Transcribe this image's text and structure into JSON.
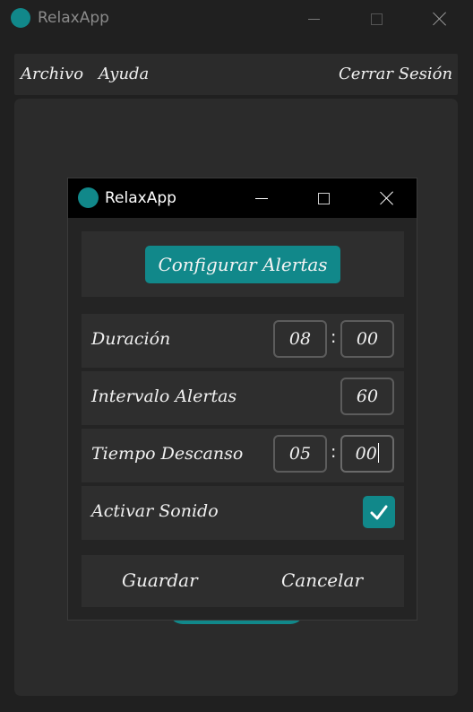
{
  "main_window": {
    "title": "RelaxApp",
    "menu": {
      "archivo": "Archivo",
      "ayuda": "Ayuda",
      "cerrar_sesion": "Cerrar Sesión"
    }
  },
  "dialog": {
    "title": "RelaxApp",
    "configure_button": "Configurar Alertas",
    "duracion": {
      "label": "Duración",
      "hours": "08",
      "separator": ":",
      "minutes": "00"
    },
    "intervalo": {
      "label": "Intervalo Alertas",
      "value": "60"
    },
    "descanso": {
      "label": "Tiempo Descanso",
      "minutes": "05",
      "separator": ":",
      "seconds": "00"
    },
    "sonido": {
      "label": "Activar Sonido",
      "checked": true
    },
    "guardar": "Guardar",
    "cancelar": "Cancelar"
  },
  "colors": {
    "accent": "#11888a",
    "background": "#202020",
    "panel": "#2b2b2b",
    "dialog_titlebar": "#000000"
  },
  "icons": {
    "app": "app-circle-icon",
    "minimize": "minimize-icon",
    "maximize": "maximize-icon",
    "close": "close-icon",
    "check": "checkmark-icon"
  }
}
